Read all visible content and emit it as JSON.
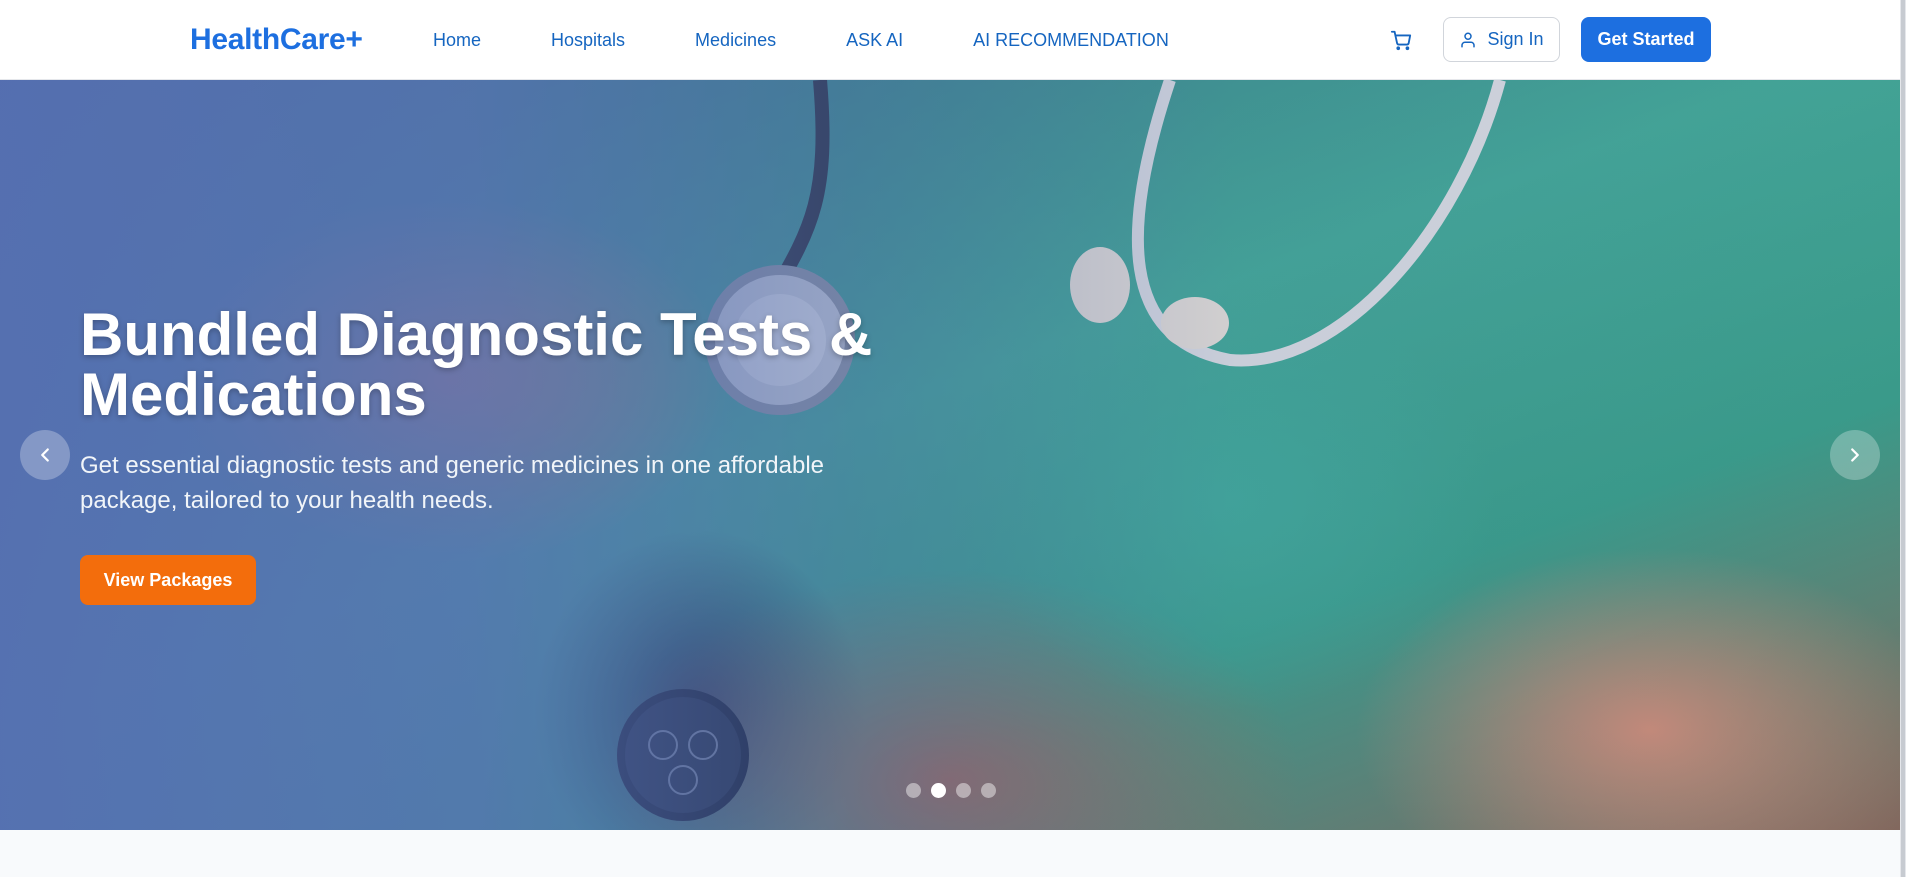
{
  "navbar": {
    "brand": "HealthCare+",
    "links": [
      {
        "label": "Home"
      },
      {
        "label": "Hospitals"
      },
      {
        "label": "Medicines"
      },
      {
        "label": "ASK AI"
      },
      {
        "label": "AI RECOMMENDATION"
      }
    ],
    "cart_icon": "shopping-cart-icon",
    "signin_label": "Sign In",
    "signin_icon": "user-icon",
    "get_started_label": "Get Started"
  },
  "hero": {
    "title": "Bundled Diagnostic Tests & Medications",
    "subtitle": "Get essential diagnostic tests and generic medicines in one affordable package, tailored to your health needs.",
    "cta_label": "View Packages",
    "prev_icon": "chevron-left-icon",
    "next_icon": "chevron-right-icon",
    "slide_count": 4,
    "active_slide": 2
  },
  "colors": {
    "brand": "#1d6fe0",
    "cta": "#f36d0c",
    "nav_text": "#1565c0"
  }
}
